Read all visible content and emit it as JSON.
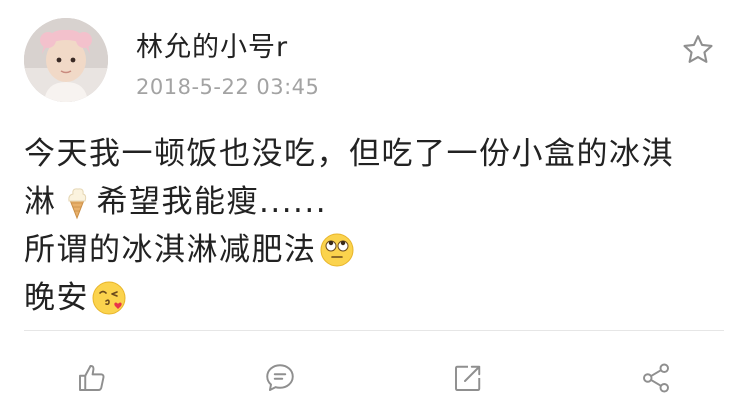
{
  "post": {
    "author": "林允的小号r",
    "timestamp": "2018-5-22 03:45",
    "lines": [
      {
        "text": "今天我一顿饭也没吃，但吃了一份小盒的冰淇",
        "emoji": null
      },
      {
        "text": "淋",
        "emoji": "ice-cream-icon",
        "after": "希望我能瘦......"
      },
      {
        "text": "所谓的冰淇淋减肥法",
        "emoji": "eye-roll-emoji-icon"
      },
      {
        "text": "晚安",
        "emoji": "kiss-emoji-icon"
      }
    ]
  },
  "actions": {
    "like": "thumbs-up-icon",
    "comment": "comment-icon",
    "repost": "repost-icon",
    "share": "share-icon"
  },
  "colors": {
    "text": "#222222",
    "timestamp": "#a3a3a3",
    "icon": "#8f8f8f",
    "divider": "#e6e6e6"
  }
}
